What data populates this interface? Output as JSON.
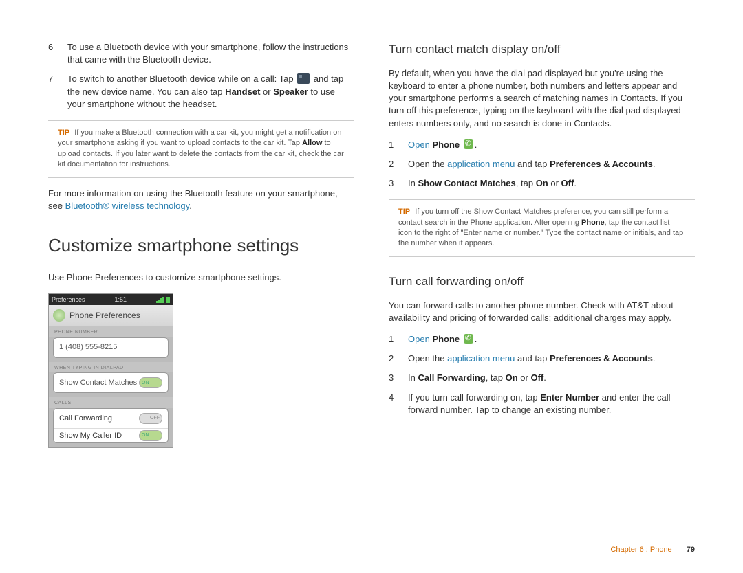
{
  "left": {
    "items": [
      {
        "n": "6",
        "html": "To use a Bluetooth device with your smartphone, follow the instructions that came with the Bluetooth device."
      },
      {
        "n": "7",
        "html": "To switch to another Bluetooth device while on a call: Tap {BT} and tap the new device name. You can also tap <strong>Handset</strong> or <strong>Speaker</strong> to use your smartphone without the headset."
      }
    ],
    "tip": "If you make a Bluetooth connection with a car kit, you might get a notification on your smartphone asking if you want to upload contacts to the car kit. Tap <strong>Allow</strong> to upload contacts. If you later want to delete the contacts from the car kit, check the car kit documentation for instructions.",
    "post": "For more information on using the Bluetooth feature on your smartphone, see <span class=\"link\">Bluetooth® wireless technology</span>.",
    "h1": "Customize smartphone settings",
    "intro": "Use Phone Preferences to customize smartphone settings.",
    "shot": {
      "back": "Preferences",
      "time": "1:51",
      "title": "Phone Preferences",
      "lbl1": "PHONE NUMBER",
      "number": "1 (408) 555-8215",
      "lbl2": "WHEN TYPING IN DIALPAD",
      "row1": "Show Contact Matches",
      "lbl3": "CALLS",
      "row2": "Call Forwarding",
      "row3": "Show My Caller ID"
    }
  },
  "right": {
    "h2a": "Turn contact match display on/off",
    "pa": "By default, when you have the dial pad displayed but you're using the keyboard to enter a phone number, both numbers and letters appear and your smartphone performs a search of matching names in Contacts. If you turn off this preference, typing on the keyboard with the dial pad displayed enters numbers only, and no search is done in Contacts.",
    "list_a": [
      {
        "n": "1",
        "html": "<span class=\"link\">Open</span> <strong>Phone</strong> {PH}."
      },
      {
        "n": "2",
        "html": "Open the <span class=\"link\">application menu</span> and tap <strong>Preferences & Accounts</strong>."
      },
      {
        "n": "3",
        "html": "In <strong>Show Contact Matches</strong>, tap <strong>On</strong> or <strong>Off</strong>."
      }
    ],
    "tip": "If you turn off the Show Contact Matches preference, you can still perform a contact search in the Phone application. After opening <strong>Phone</strong>, tap the contact list icon to the right of \"Enter name or number.\" Type the contact name or initials, and tap the number when it appears.",
    "h2b": "Turn call forwarding on/off",
    "pb": "You can forward calls to another phone number. Check with AT&T about availability and pricing of forwarded calls; additional charges may apply.",
    "list_b": [
      {
        "n": "1",
        "html": "<span class=\"link\">Open</span> <strong>Phone</strong> {PH}."
      },
      {
        "n": "2",
        "html": "Open the <span class=\"link\">application menu</span> and tap <strong>Preferences & Accounts</strong>."
      },
      {
        "n": "3",
        "html": "In <strong>Call Forwarding</strong>, tap <strong>On</strong> or <strong>Off</strong>."
      },
      {
        "n": "4",
        "html": "If you turn call forwarding on, tap <strong>Enter Number</strong> and enter the call forward number. Tap to change an existing number."
      }
    ]
  },
  "footer": {
    "chapter": "Chapter 6 : Phone",
    "page": "79"
  },
  "tip_label": "TIP"
}
